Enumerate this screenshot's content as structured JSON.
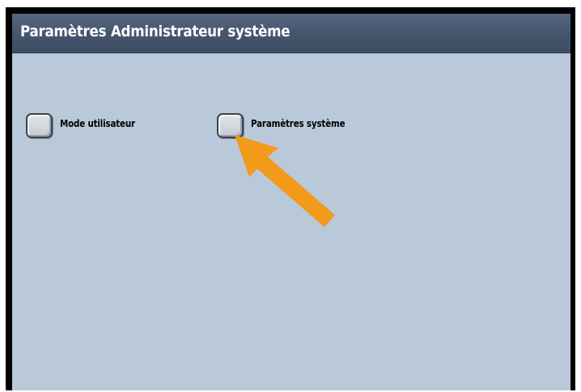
{
  "window": {
    "title": "Paramètres Administrateur système"
  },
  "options": {
    "user_mode": {
      "label": "Mode utilisateur",
      "checked": false
    },
    "system_settings": {
      "label": "Paramètres système",
      "checked": false
    }
  },
  "annotation": {
    "arrow_icon": "pointer-arrow-icon",
    "arrow_color": "#f39a1b",
    "points_to": "system_settings"
  },
  "colors": {
    "title_bar": "#44556c",
    "panel_background": "#b9c9da",
    "title_text": "#ffffff"
  }
}
